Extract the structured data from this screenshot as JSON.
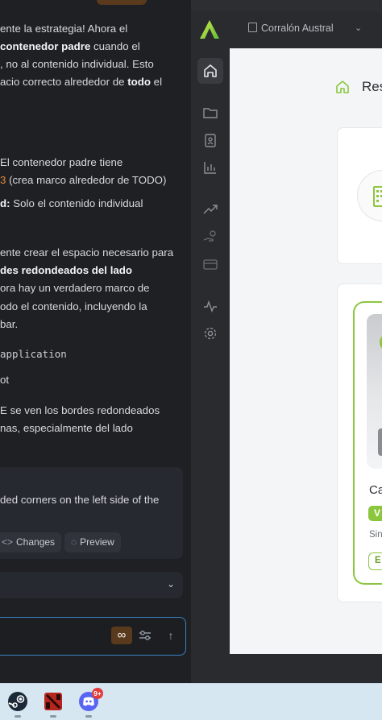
{
  "chat": {
    "lines": [
      {
        "segments": [
          {
            "t": "ente la estrategia! Ahora el",
            "b": false
          }
        ]
      },
      {
        "segments": [
          {
            "t": "contenedor padre",
            "b": true
          },
          {
            "t": " cuando el",
            "b": false
          }
        ]
      },
      {
        "segments": [
          {
            "t": ", no al contenido individual. Esto",
            "b": false
          }
        ]
      },
      {
        "segments": [
          {
            "t": "acio correcto alrededor de ",
            "b": false
          },
          {
            "t": "todo",
            "b": true
          },
          {
            "t": " el",
            "b": false
          }
        ]
      },
      {
        "segments": [
          {
            "t": "El contenedor padre tiene",
            "b": false
          }
        ]
      },
      {
        "segments": [
          {
            "t": "3",
            "b": false,
            "c": "orange"
          },
          {
            "t": "  (crea marco alrededor de TODO)",
            "b": false
          }
        ]
      },
      {
        "segments": [
          {
            "t": "d:",
            "b": true
          },
          {
            "t": " Solo el contenido individual",
            "b": false
          }
        ]
      },
      {
        "segments": [
          {
            "t": "ente crear el espacio necesario para",
            "b": false
          }
        ]
      },
      {
        "segments": [
          {
            "t": "des redondeados del lado",
            "b": true
          }
        ]
      },
      {
        "segments": [
          {
            "t": "ora hay un verdadero marco de",
            "b": false
          }
        ]
      },
      {
        "segments": [
          {
            "t": "odo el contenido, incluyendo la",
            "b": false
          }
        ]
      },
      {
        "segments": [
          {
            "t": "bar.",
            "b": false
          }
        ]
      },
      {
        "segments": [
          {
            "t": " application",
            "b": false,
            "c": "mono"
          }
        ]
      },
      {
        "segments": [
          {
            "t": "ot",
            "b": false
          }
        ]
      },
      {
        "segments": [
          {
            "t": "E se ven los bordes redondeados",
            "b": false
          }
        ]
      },
      {
        "segments": [
          {
            "t": "nas, especialmente del lado",
            "b": false
          }
        ]
      }
    ],
    "prompt_text": "ded corners on the left side of the",
    "changes_label": "Changes",
    "preview_label": "Preview",
    "infinity_symbol": "∞"
  },
  "app": {
    "org_name": "Corralón Austral",
    "page_title": "Res",
    "card_title": "Ca",
    "badge_letter": "V",
    "subtitle": "Sin",
    "button_letter": "E",
    "accent": "#8cc63f"
  },
  "taskbar": {
    "apps": [
      "steam-icon",
      "dota-icon",
      "discord-icon"
    ],
    "discord_badge": "9+"
  }
}
